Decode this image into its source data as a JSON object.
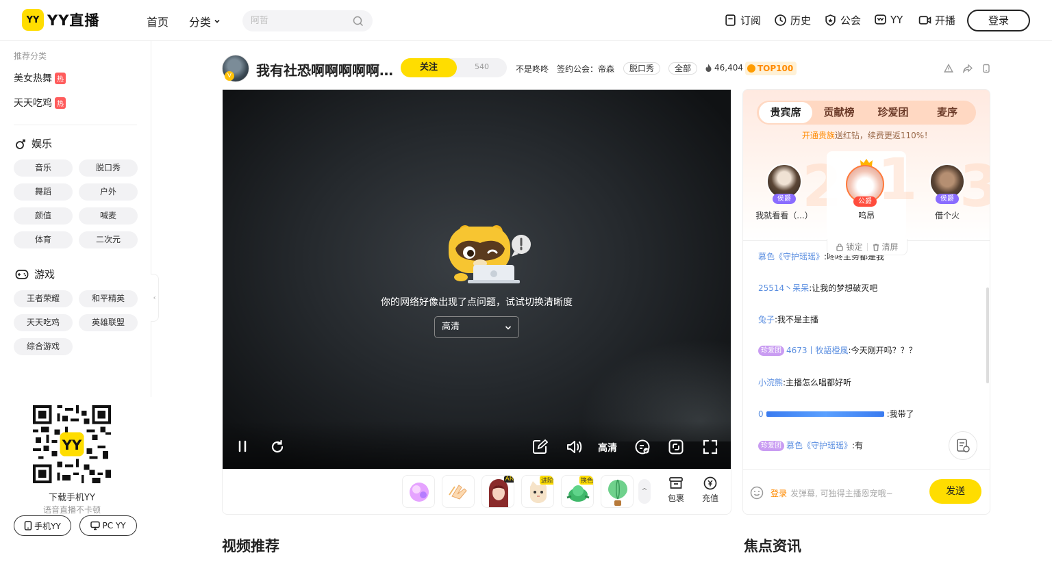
{
  "header": {
    "logo_badge": "YY",
    "logo_text": "YY直播",
    "nav": {
      "home": "首页",
      "category": "分类"
    },
    "search_placeholder": "阿哲",
    "right": {
      "subscribe": "订阅",
      "history": "历史",
      "guild": "公会",
      "yy": "YY",
      "broadcast": "开播",
      "login": "登录"
    }
  },
  "sidebar": {
    "recommend_title": "推荐分类",
    "hot_items": [
      {
        "label": "美女热舞",
        "badge": "热"
      },
      {
        "label": "天天吃鸡",
        "badge": "热"
      }
    ],
    "entertainment": {
      "title": "娱乐",
      "chips": [
        "音乐",
        "脱口秀",
        "舞蹈",
        "户外",
        "颜值",
        "喊麦",
        "体育",
        "二次元"
      ]
    },
    "games": {
      "title": "游戏",
      "chips": [
        "王者荣耀",
        "和平精英",
        "天天吃鸡",
        "英雄联盟",
        "综合游戏"
      ]
    },
    "collapse": "‹",
    "download": {
      "logo": "YY",
      "title": "下载手机YY",
      "subtitle": "语音直播不卡顿",
      "mobile_btn": "手机YY",
      "pc_btn": "PC YY"
    }
  },
  "room": {
    "avatar_badge": "V",
    "title": "我有社恐啊啊啊啊啊啊啊啊",
    "follow_label": "关注",
    "follow_count": "540",
    "anchor_name": "不是咚咚",
    "guild": "签约公会：帝森",
    "tag1": "脱口秀",
    "tag2": "全部",
    "heat": "46,404",
    "top_badge": "TOP100"
  },
  "player": {
    "error_message": "你的网络好像出现了点问题，试试切换清晰度",
    "quality_select": "高清",
    "quality_label": "高清"
  },
  "gifts": {
    "tags": {
      "g3": "AR",
      "g4": "进阶",
      "g5": "换色"
    },
    "expand": "^",
    "bag": "包裹",
    "recharge": "充值"
  },
  "vip_panel": {
    "tabs": [
      "贵宾席",
      "贡献榜",
      "珍爱团",
      "麦序"
    ],
    "tip_highlight": "开通贵族",
    "tip_rest": "送红钻，续费更返110%！",
    "rank_numbers": [
      "2",
      "1",
      "3"
    ],
    "ranks": [
      {
        "name": "我就看看（...）",
        "badge": "侯爵"
      },
      {
        "name": "呜昂",
        "badge": "公爵"
      },
      {
        "name": "借个火",
        "badge": "侯爵"
      }
    ],
    "lock": "锁定",
    "clear": "清屏"
  },
  "chat": {
    "messages": [
      {
        "user": "慕色《守护瑶瑶》",
        "text": ":咚咚主务都是我"
      },
      {
        "user": "25514丶呆呆",
        "text": ":让我的梦想破灭吧"
      },
      {
        "user": "兔子",
        "text": ":我不是主播"
      },
      {
        "user": "4673丨牧語橙風",
        "text": ":今天刚开吗？？？",
        "badge": "珍爱团"
      },
      {
        "user": "小浣熊",
        "text": ":主播怎么唱都好听"
      },
      {
        "user": "0",
        "text": ":我带了"
      },
      {
        "user": "慕色《守护瑶瑶》",
        "text": ":有",
        "badge": "珍爱团"
      }
    ],
    "input_login": "登录",
    "input_placeholder": "发弹幕, 可独得主播恩宠哦~",
    "send": "发送"
  },
  "sections": {
    "videos": "视频推荐",
    "news": "焦点资讯"
  },
  "colors": {
    "brand_yellow": "#ffdd00",
    "hot_red": "#ff5c5c",
    "link_blue": "#5a8ee0",
    "noble_orange": "#ff8a00"
  }
}
